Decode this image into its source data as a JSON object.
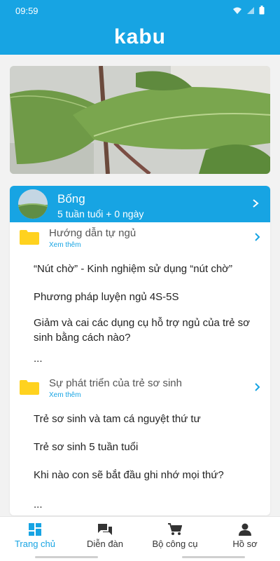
{
  "status_bar": {
    "time": "09:59"
  },
  "app": {
    "logo_text": "kabu"
  },
  "baby": {
    "name": "Bống",
    "age": "5 tuần tuổi + 0 ngày"
  },
  "sections": [
    {
      "title": "Hướng dẫn tự ngủ",
      "more": "Xem thêm",
      "articles": [
        "“Nút chờ” - Kinh nghiệm sử dụng “nút chờ”",
        "Phương pháp luyện ngủ 4S-5S",
        "Giảm và cai các dụng cụ hỗ trợ ngủ của trẻ sơ sinh bằng cách nào?",
        "..."
      ]
    },
    {
      "title": "Sự phát triển của trẻ sơ sinh",
      "more": "Xem thêm",
      "articles": [
        "Trẻ sơ sinh và tam cá nguyệt thứ tư",
        "Trẻ sơ sinh 5 tuần tuổi",
        "Khi nào con sẽ bắt đầu ghi nhớ mọi thứ?",
        "..."
      ]
    }
  ],
  "nav": [
    {
      "label": "Trang chủ",
      "icon": "home-grid-icon",
      "active": true
    },
    {
      "label": "Diễn đàn",
      "icon": "forum-chat-icon",
      "active": false
    },
    {
      "label": "Bộ công cụ",
      "icon": "cart-icon",
      "active": false
    },
    {
      "label": "Hồ sơ",
      "icon": "person-icon",
      "active": false
    }
  ],
  "colors": {
    "brand": "#17a4e3",
    "folder": "#ffd21f",
    "nav_inactive": "#333333"
  }
}
